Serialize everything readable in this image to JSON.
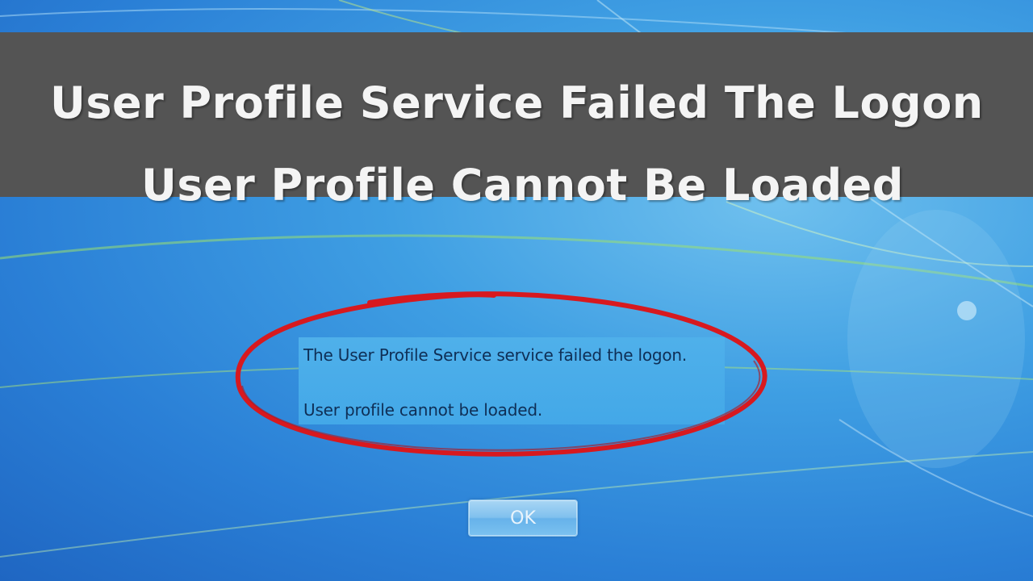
{
  "banner": {
    "line1": "User Profile Service Failed The Logon",
    "line2": "User Profile Cannot Be Loaded",
    "background_color": "#545454",
    "text_color": "#f4f4f4"
  },
  "dialog": {
    "message_line1": "The User Profile Service service failed the logon.",
    "message_line2": "User profile cannot be loaded.",
    "ok_label": "OK"
  },
  "annotation": {
    "highlight_color": "#d7191f",
    "icon": "red-circle-highlight"
  },
  "wallpaper": {
    "base_color": "#3f9fe3",
    "accent_color": "#a6e27a"
  }
}
